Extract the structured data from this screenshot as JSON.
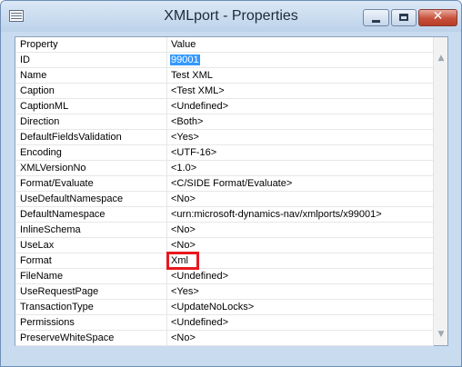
{
  "window": {
    "title": "XMLport - Properties"
  },
  "controls": {
    "close_glyph": "✕"
  },
  "scroll": {
    "up_glyph": "▲",
    "down_glyph": "▼"
  },
  "grid": {
    "header": {
      "property": "Property",
      "value": "Value"
    },
    "rows": [
      {
        "property": "ID",
        "value": "99001"
      },
      {
        "property": "Name",
        "value": "Test XML"
      },
      {
        "property": "Caption",
        "value": "<Test XML>"
      },
      {
        "property": "CaptionML",
        "value": "<Undefined>"
      },
      {
        "property": "Direction",
        "value": "<Both>"
      },
      {
        "property": "DefaultFieldsValidation",
        "value": "<Yes>"
      },
      {
        "property": "Encoding",
        "value": "<UTF-16>"
      },
      {
        "property": "XMLVersionNo",
        "value": "<1.0>"
      },
      {
        "property": "Format/Evaluate",
        "value": "<C/SIDE Format/Evaluate>"
      },
      {
        "property": "UseDefaultNamespace",
        "value": "<No>"
      },
      {
        "property": "DefaultNamespace",
        "value": "<urn:microsoft-dynamics-nav/xmlports/x99001>"
      },
      {
        "property": "InlineSchema",
        "value": "<No>"
      },
      {
        "property": "UseLax",
        "value": "<No>"
      },
      {
        "property": "Format",
        "value": "Xml"
      },
      {
        "property": "FileName",
        "value": "<Undefined>"
      },
      {
        "property": "UseRequestPage",
        "value": "<Yes>"
      },
      {
        "property": "TransactionType",
        "value": "<UpdateNoLocks>"
      },
      {
        "property": "Permissions",
        "value": "<Undefined>"
      },
      {
        "property": "PreserveWhiteSpace",
        "value": "<No>"
      }
    ]
  },
  "colors": {
    "selection": "#3399ff",
    "highlight_box": "#e8171e"
  }
}
